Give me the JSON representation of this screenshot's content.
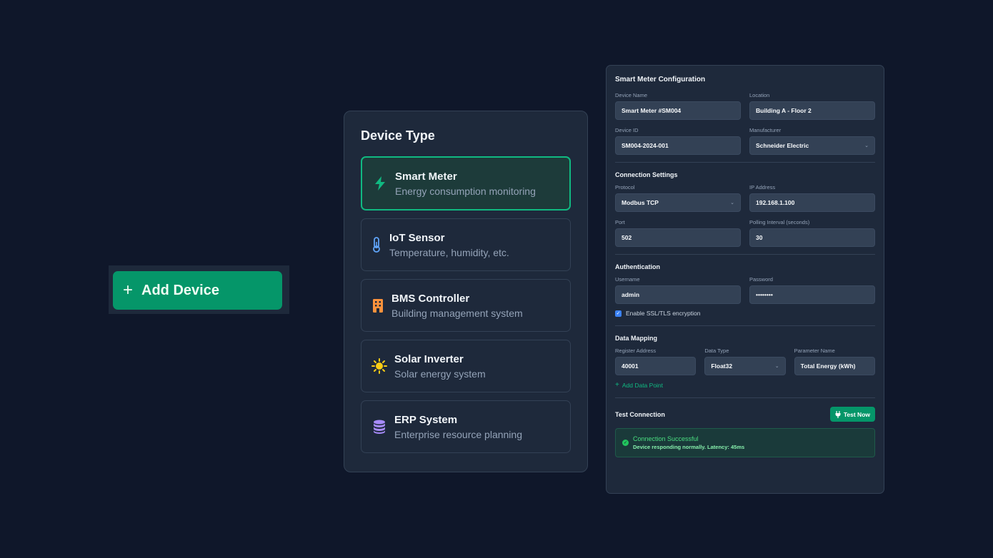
{
  "add_device": {
    "label": "Add Device",
    "icon": "plus-icon"
  },
  "device_type": {
    "title": "Device Type",
    "items": [
      {
        "name": "Smart Meter",
        "desc": "Energy consumption monitoring",
        "icon": "lightning-icon",
        "color": "#10b981",
        "selected": true
      },
      {
        "name": "IoT Sensor",
        "desc": "Temperature, humidity, etc.",
        "icon": "thermometer-icon",
        "color": "#60a5fa"
      },
      {
        "name": "BMS Controller",
        "desc": "Building management system",
        "icon": "building-icon",
        "color": "#fb923c"
      },
      {
        "name": "Solar Inverter",
        "desc": "Solar energy system",
        "icon": "sun-icon",
        "color": "#facc15"
      },
      {
        "name": "ERP System",
        "desc": "Enterprise resource planning",
        "icon": "database-icon",
        "color": "#a78bfa"
      }
    ]
  },
  "config": {
    "title": "Smart Meter Configuration",
    "device_name_label": "Device Name",
    "device_name": "Smart Meter #SM004",
    "location_label": "Location",
    "location": "Building A - Floor 2",
    "device_id_label": "Device ID",
    "device_id": "SM004-2024-001",
    "manufacturer_label": "Manufacturer",
    "manufacturer": "Schneider Electric",
    "connection": {
      "title": "Connection Settings",
      "protocol_label": "Protocol",
      "protocol": "Modbus TCP",
      "ip_label": "IP Address",
      "ip": "192.168.1.100",
      "port_label": "Port",
      "port": "502",
      "polling_label": "Polling Interval (seconds)",
      "polling": "30"
    },
    "auth": {
      "title": "Authentication",
      "username_label": "Username",
      "username": "admin",
      "password_label": "Password",
      "password": "••••••••",
      "ssl_label": "Enable SSL/TLS encryption",
      "ssl_checked": true
    },
    "mapping": {
      "title": "Data Mapping",
      "register_label": "Register Address",
      "register": "40001",
      "datatype_label": "Data Type",
      "datatype": "Float32",
      "param_label": "Parameter Name",
      "param": "Total Energy (kWh)",
      "add_label": "Add Data Point"
    },
    "test": {
      "title": "Test Connection",
      "button": "Test Now",
      "status_title": "Connection Successful",
      "status_desc": "Device responding normally. Latency: 45ms"
    }
  }
}
